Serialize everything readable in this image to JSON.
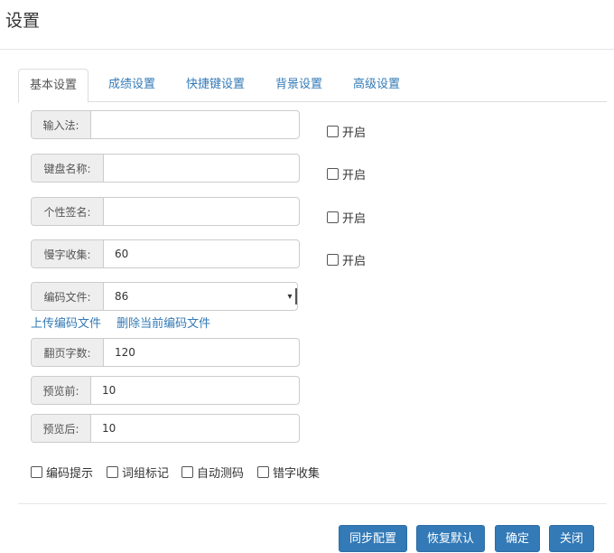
{
  "title": "设置",
  "tabs": [
    "基本设置",
    "成绩设置",
    "快捷键设置",
    "背景设置",
    "高级设置"
  ],
  "fields": {
    "input_method": {
      "label": "输入法:",
      "value": ""
    },
    "keyboard_name": {
      "label": "键盘名称:",
      "value": ""
    },
    "signature": {
      "label": "个性签名:",
      "value": ""
    },
    "slow_collect": {
      "label": "慢字收集:",
      "value": "60"
    },
    "encoding_file": {
      "label": "编码文件:",
      "value": "86"
    },
    "page_chars": {
      "label": "翻页字数:",
      "value": "120"
    },
    "preview_before": {
      "label": "预览前:",
      "value": "10"
    },
    "preview_after": {
      "label": "预览后:",
      "value": "10"
    }
  },
  "enable_label": "开启",
  "links": {
    "upload": "上传编码文件",
    "delete": "删除当前编码文件"
  },
  "options": [
    "编码提示",
    "词组标记",
    "自动测码",
    "错字收集"
  ],
  "buttons": {
    "sync": "同步配置",
    "restore": "恢复默认",
    "ok": "确定",
    "close": "关闭"
  }
}
